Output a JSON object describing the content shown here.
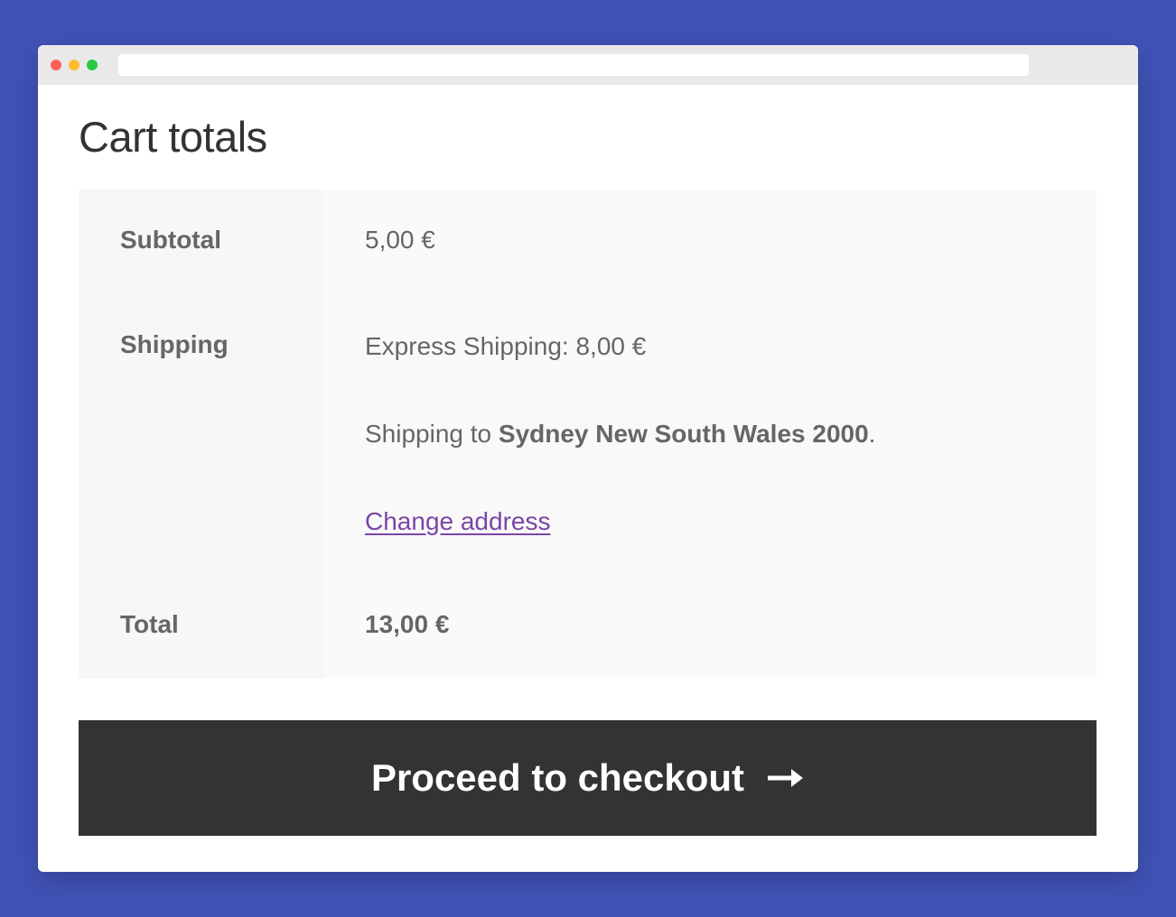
{
  "window": {
    "colors": {
      "background": "#4052b5",
      "button": "#333333",
      "link": "#7b45a7"
    }
  },
  "cart": {
    "title": "Cart totals",
    "subtotal": {
      "label": "Subtotal",
      "value": "5,00 €"
    },
    "shipping": {
      "label": "Shipping",
      "method": "Express Shipping: 8,00 €",
      "destination_prefix": "Shipping to ",
      "destination": "Sydney New South Wales 2000",
      "destination_suffix": ".",
      "change_address_label": "Change address"
    },
    "total": {
      "label": "Total",
      "value": "13,00 €"
    },
    "checkout_label": "Proceed to checkout",
    "checkout_icon": "arrow-right-icon"
  }
}
